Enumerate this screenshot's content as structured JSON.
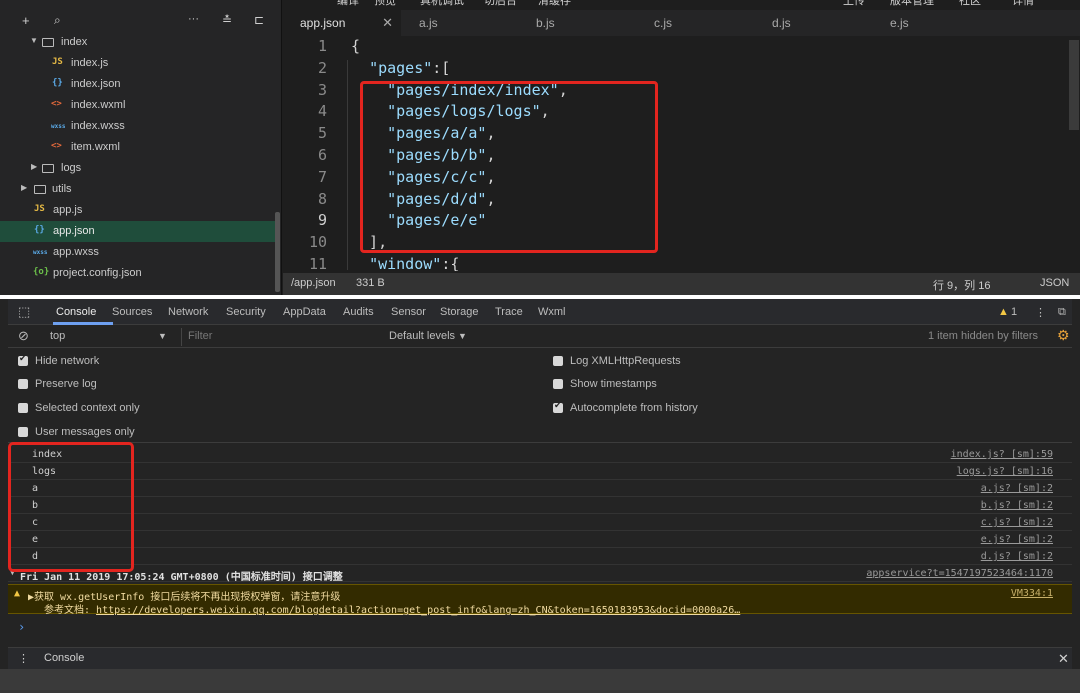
{
  "menu": {
    "items": [
      "编译",
      "预览",
      "真机调试",
      "切后台",
      "清缓存",
      "上传",
      "版本管理",
      "社区",
      "详情"
    ]
  },
  "sidebar": {
    "toolbar": {
      "add": "+",
      "search": "🔍",
      "more": "···",
      "sort": "≛",
      "split": "⊏"
    },
    "tree": [
      {
        "label": "index",
        "icon": "",
        "kind": "folder-open"
      },
      {
        "label": "index.js",
        "icon": "JS",
        "kind": "js"
      },
      {
        "label": "index.json",
        "icon": "{}",
        "kind": "json"
      },
      {
        "label": "index.wxml",
        "icon": "<>",
        "kind": "wxml"
      },
      {
        "label": "index.wxss",
        "icon": "wxss",
        "kind": "wxss"
      },
      {
        "label": "item.wxml",
        "icon": "<>",
        "kind": "wxml"
      },
      {
        "label": "logs",
        "icon": "",
        "kind": "folder"
      },
      {
        "label": "utils",
        "icon": "",
        "kind": "folder"
      },
      {
        "label": "app.js",
        "icon": "JS",
        "kind": "js"
      },
      {
        "label": "app.json",
        "icon": "{}",
        "kind": "json"
      },
      {
        "label": "app.wxss",
        "icon": "wxss",
        "kind": "wxss"
      },
      {
        "label": "project.config.json",
        "icon": "{o}",
        "kind": "cfg"
      }
    ]
  },
  "editor": {
    "tabs": [
      {
        "label": "app.json",
        "close": "✕"
      },
      {
        "label": "a.js"
      },
      {
        "label": "b.js"
      },
      {
        "label": "c.js"
      },
      {
        "label": "d.js"
      },
      {
        "label": "e.js"
      }
    ],
    "lines": [
      {
        "n": "1",
        "pre": "{",
        "str": "",
        "post": ""
      },
      {
        "n": "2",
        "pre": "  ",
        "str": "\"pages\"",
        "post": ":["
      },
      {
        "n": "3",
        "pre": "    ",
        "str": "\"pages/index/index\"",
        "post": ","
      },
      {
        "n": "4",
        "pre": "    ",
        "str": "\"pages/logs/logs\"",
        "post": ","
      },
      {
        "n": "5",
        "pre": "    ",
        "str": "\"pages/a/a\"",
        "post": ","
      },
      {
        "n": "6",
        "pre": "    ",
        "str": "\"pages/b/b\"",
        "post": ","
      },
      {
        "n": "7",
        "pre": "    ",
        "str": "\"pages/c/c\"",
        "post": ","
      },
      {
        "n": "8",
        "pre": "    ",
        "str": "\"pages/d/d\"",
        "post": ","
      },
      {
        "n": "9",
        "pre": "    ",
        "str": "\"pages/e/e\"",
        "post": ""
      },
      {
        "n": "10",
        "pre": "  ],",
        "str": "",
        "post": ""
      },
      {
        "n": "11",
        "pre": "  ",
        "str": "\"window\"",
        "post": ":{"
      }
    ],
    "status": {
      "path": "/app.json",
      "size": "331 B",
      "position": "行 9，列 16",
      "lang": "JSON"
    }
  },
  "devtools": {
    "tabs": [
      "Console",
      "Sources",
      "Network",
      "Security",
      "AppData",
      "Audits",
      "Sensor",
      "Storage",
      "Trace",
      "Wxml"
    ],
    "warning_count": "1",
    "toolbar": {
      "context": "top",
      "filter_placeholder": "Filter",
      "levels": "Default levels",
      "hidden": "1 item hidden by filters"
    },
    "options_left": [
      {
        "label": "Hide network",
        "checked": true
      },
      {
        "label": "Preserve log",
        "checked": false
      },
      {
        "label": "Selected context only",
        "checked": false
      },
      {
        "label": "User messages only",
        "checked": false
      }
    ],
    "options_right": [
      {
        "label": "Log XMLHttpRequests",
        "checked": false
      },
      {
        "label": "Show timestamps",
        "checked": false
      },
      {
        "label": "Autocomplete from history",
        "checked": true
      }
    ],
    "logs": [
      {
        "msg": "index",
        "src": "index.js? [sm]:59"
      },
      {
        "msg": "logs",
        "src": "logs.js? [sm]:16"
      },
      {
        "msg": "a",
        "src": "a.js? [sm]:2"
      },
      {
        "msg": "b",
        "src": "b.js? [sm]:2"
      },
      {
        "msg": "c",
        "src": "c.js? [sm]:2"
      },
      {
        "msg": "e",
        "src": "e.js? [sm]:2"
      },
      {
        "msg": "d",
        "src": "d.js? [sm]:2"
      }
    ],
    "group": {
      "msg": "Fri Jan 11 2019 17:05:24 GMT+0800 (中国标准时间) 接口调整",
      "src": "appservice?t=1547197523464:1170"
    },
    "warning": {
      "line1": "▶获取  wx.getUserInfo 接口后续将不再出现授权弹窗，请注意升级",
      "line2_prefix": "参考文档: ",
      "line2_link": "https://developers.weixin.qq.com/blogdetail?action=get_post_info&lang=zh_CN&token=1650183953&docid=0000a26…",
      "src": "VM334:1"
    },
    "prompt": "›",
    "drawer": {
      "tab": "Console",
      "close": "✕",
      "menu": "⋮"
    }
  }
}
